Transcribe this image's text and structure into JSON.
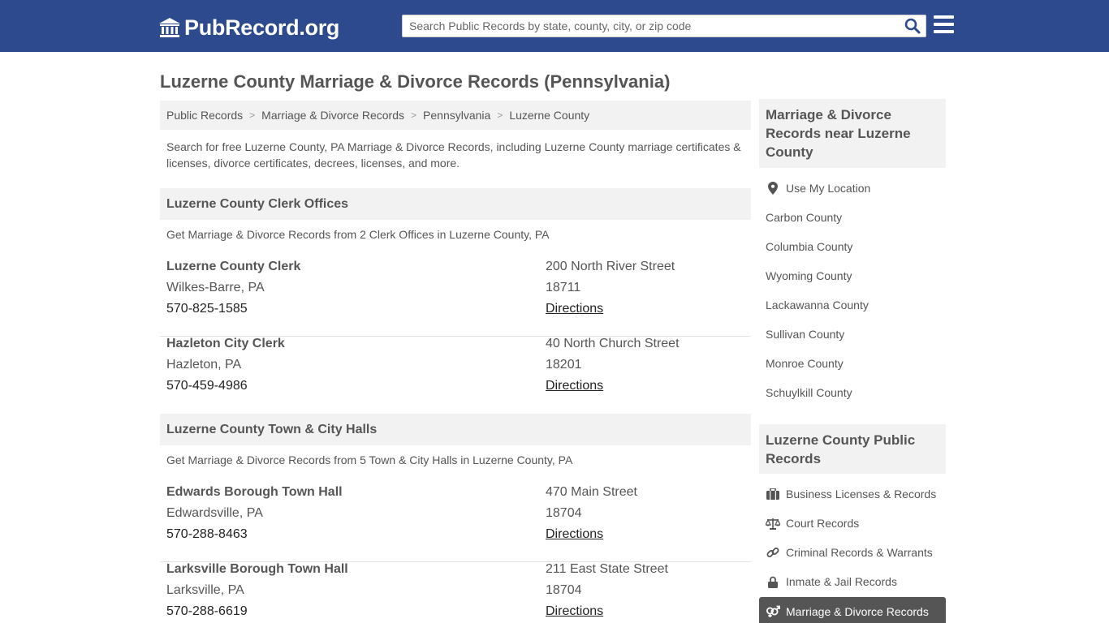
{
  "header": {
    "logo_text": "PubRecord.org",
    "search_placeholder": "Search Public Records by state, county, city, or zip code"
  },
  "page_title": "Luzerne County Marriage & Divorce Records (Pennsylvania)",
  "breadcrumb": [
    "Public Records",
    "Marriage & Divorce Records",
    "Pennsylvania",
    "Luzerne County"
  ],
  "intro": "Search for free Luzerne County, PA Marriage & Divorce Records, including Luzerne County marriage certificates & licenses, divorce certificates, decrees, licenses, and more.",
  "clerk_section": {
    "title": "Luzerne County Clerk Offices",
    "desc": "Get Marriage & Divorce Records from 2 Clerk Offices in Luzerne County, PA",
    "offices": [
      {
        "name": "Luzerne County Clerk",
        "city": "Wilkes-Barre, PA",
        "phone": "570-825-1585",
        "street": "200 North River Street",
        "zip": "18711",
        "link": "Directions"
      },
      {
        "name": "Hazleton City Clerk",
        "city": "Hazleton, PA",
        "phone": "570-459-4986",
        "street": "40 North Church Street",
        "zip": "18201",
        "link": "Directions"
      }
    ]
  },
  "hall_section": {
    "title": "Luzerne County Town & City Halls",
    "desc": "Get Marriage & Divorce Records from 5 Town & City Halls in Luzerne County, PA",
    "offices": [
      {
        "name": "Edwards Borough Town Hall",
        "city": "Edwardsville, PA",
        "phone": "570-288-8463",
        "street": "470 Main Street",
        "zip": "18704",
        "link": "Directions"
      },
      {
        "name": "Larksville Borough Town Hall",
        "city": "Larksville, PA",
        "phone": "570-288-6619",
        "street": "211 East State Street",
        "zip": "18704",
        "link": "Directions"
      }
    ]
  },
  "sidebar": {
    "nearby_title": "Marriage & Divorce Records near Luzerne County",
    "use_location": "Use My Location",
    "nearby": [
      "Carbon County",
      "Columbia County",
      "Wyoming County",
      "Lackawanna County",
      "Sullivan County",
      "Monroe County",
      "Schuylkill County"
    ],
    "public_title": "Luzerne County Public Records",
    "public_links": [
      {
        "label": "Business Licenses & Records",
        "icon": "briefcase-icon"
      },
      {
        "label": "Court Records",
        "icon": "scales-icon"
      },
      {
        "label": "Criminal Records & Warrants",
        "icon": "link-icon"
      },
      {
        "label": "Inmate & Jail Records",
        "icon": "lock-icon"
      }
    ],
    "active_link": "Marriage & Divorce Records",
    "active_icon": "venus-mars-icon"
  },
  "colors": {
    "header_bg": "#2e4a8e",
    "panel_bg": "#f2f2f2",
    "active_bg": "#555555"
  }
}
